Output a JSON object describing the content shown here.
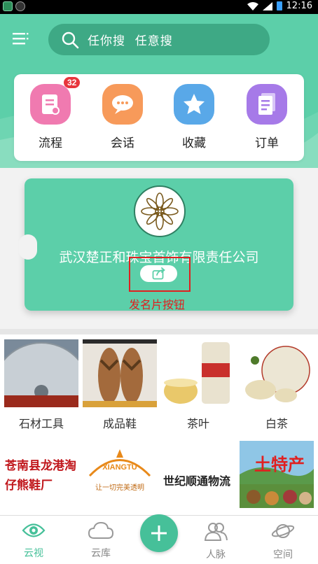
{
  "status_bar": {
    "time": "12:16"
  },
  "search": {
    "placeholder": "任你搜   任意搜"
  },
  "quick_actions": [
    {
      "label": "流程",
      "icon": "document-icon",
      "color": "#f07ab0",
      "badge": "32"
    },
    {
      "label": "会话",
      "icon": "chat-bubble-icon",
      "color": "#f79a5a"
    },
    {
      "label": "收藏",
      "icon": "star-icon",
      "color": "#59a8e8"
    },
    {
      "label": "订单",
      "icon": "list-icon",
      "color": "#a67ae8"
    }
  ],
  "business_card": {
    "company": "武汉楚正和珠宝首饰有限责任公司",
    "annotation": "发名片按钮"
  },
  "products": [
    {
      "name": "石材工具",
      "image": "saw-blade-image"
    },
    {
      "name": "成品鞋",
      "image": "sandals-image"
    },
    {
      "name": "茶叶",
      "image": "tea-jar-image"
    },
    {
      "name": "白茶",
      "image": "tea-cake-image"
    }
  ],
  "banners": [
    {
      "text_line1": "苍南县龙港淘",
      "text_line2": "仔熊鞋厂",
      "color": "#c0161b"
    },
    {
      "logo_text": "XIANGTU",
      "slogan": "让一切完美透明",
      "color": "#e8891a"
    },
    {
      "text": "世纪顺通物流",
      "color": "#222222"
    },
    {
      "overlay": "土特产",
      "color": "#e02020"
    }
  ],
  "tabs": [
    {
      "label": "云视",
      "icon": "eye-icon",
      "active": true
    },
    {
      "label": "云库",
      "icon": "cloud-icon",
      "active": false
    },
    {
      "label": "人脉",
      "icon": "contacts-icon",
      "active": false
    },
    {
      "label": "空间",
      "icon": "planet-icon",
      "active": false
    }
  ],
  "colors": {
    "accent": "#5ccfa9",
    "accent_dark": "#3ea985",
    "annotation": "#e02020"
  }
}
